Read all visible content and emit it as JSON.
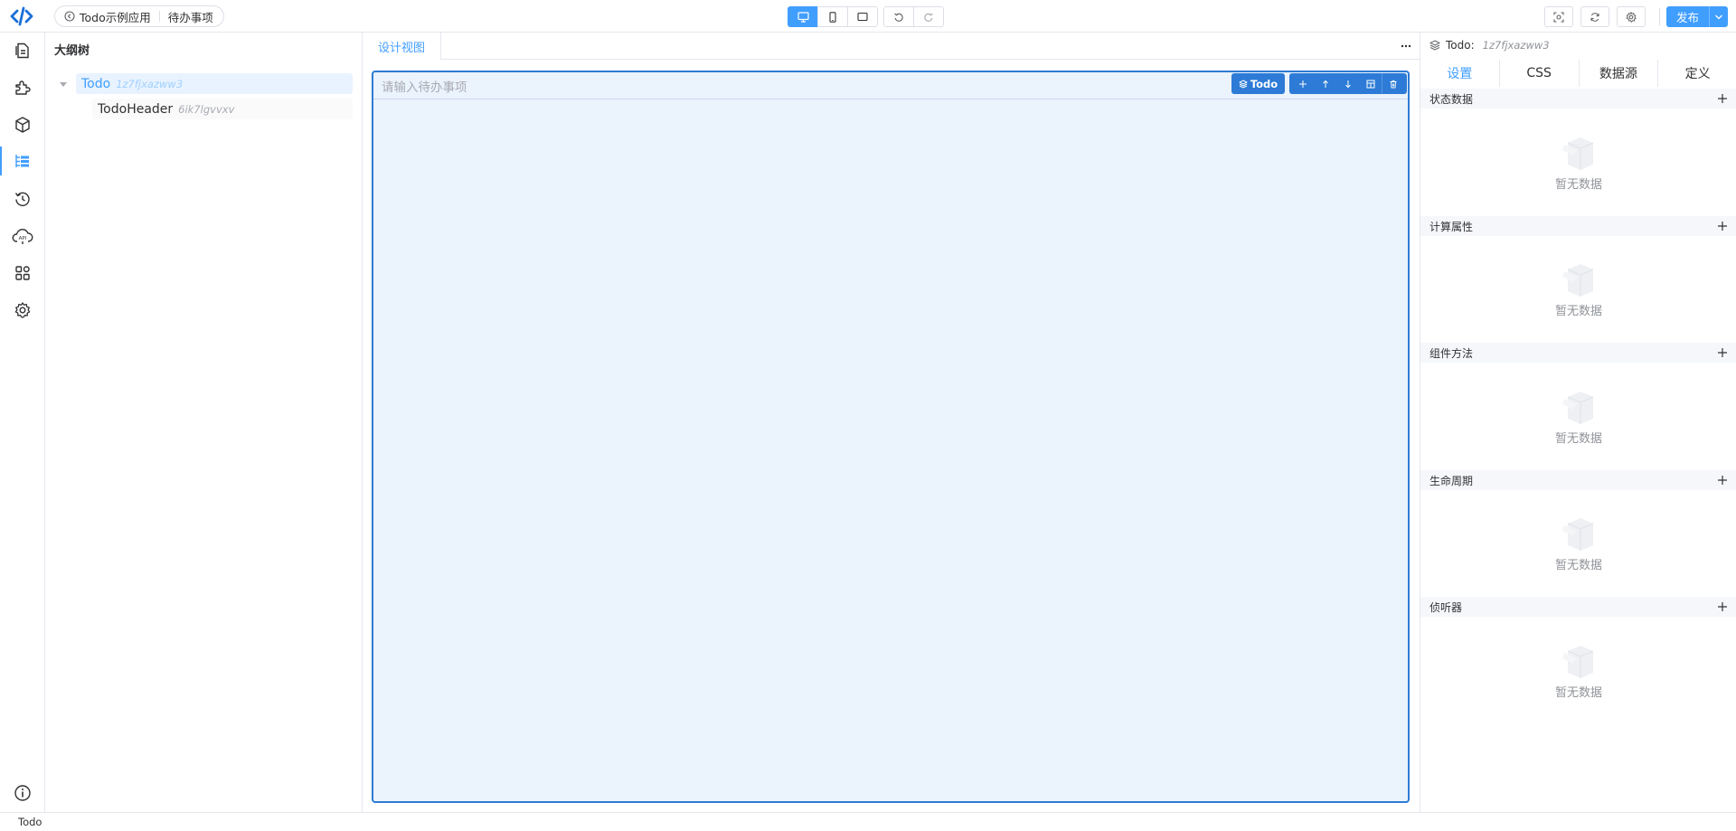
{
  "app": {
    "name": "Todo示例应用",
    "page": "待办事项"
  },
  "toolbar": {
    "devices": [
      "desktop-icon",
      "mobile-icon",
      "tablet-icon"
    ],
    "active_device": "desktop",
    "history": [
      "undo-icon",
      "redo-icon"
    ],
    "right_icons": [
      "screenshot-icon",
      "refresh-icon",
      "gear-icon"
    ],
    "publish_label": "发布"
  },
  "activity_bar": {
    "items": [
      "pages-icon",
      "plugin-icon",
      "box-icon",
      "outline-tree-icon",
      "history-icon",
      "api-cloud-icon",
      "apps-grid-icon",
      "settings-icon"
    ],
    "active": "outline-tree-icon",
    "bottom": "info-icon"
  },
  "outline": {
    "title": "大纲树",
    "nodes": [
      {
        "name": "Todo",
        "id": "1z7fjxazww3",
        "selected": true
      },
      {
        "name": "TodoHeader",
        "id": "6ik7lgvvxv",
        "selected": false
      }
    ]
  },
  "center": {
    "tab_label": "设计视图",
    "input_placeholder": "请输入待办事项",
    "component_tag": "Todo",
    "component_tools": [
      "move-icon",
      "arrow-up-icon",
      "arrow-down-icon",
      "layout-icon",
      "delete-icon"
    ]
  },
  "right_panel": {
    "component_label": "Todo:",
    "component_id": "1z7fjxazww3",
    "tabs": [
      "设置",
      "CSS",
      "数据源",
      "定义"
    ],
    "active_tab": "设置",
    "sections": [
      {
        "title": "状态数据",
        "empty_text": "暂无数据"
      },
      {
        "title": "计算属性",
        "empty_text": "暂无数据"
      },
      {
        "title": "组件方法",
        "empty_text": "暂无数据"
      },
      {
        "title": "生命周期",
        "empty_text": "暂无数据"
      },
      {
        "title": "侦听器",
        "empty_text": "暂无数据"
      }
    ]
  },
  "status_bar": {
    "text": "Todo"
  },
  "colors": {
    "accent": "#409eff",
    "canvas_border": "#2d7bd6",
    "canvas_bg": "#ebf3fd",
    "selected_bg": "#e8f3ff"
  }
}
